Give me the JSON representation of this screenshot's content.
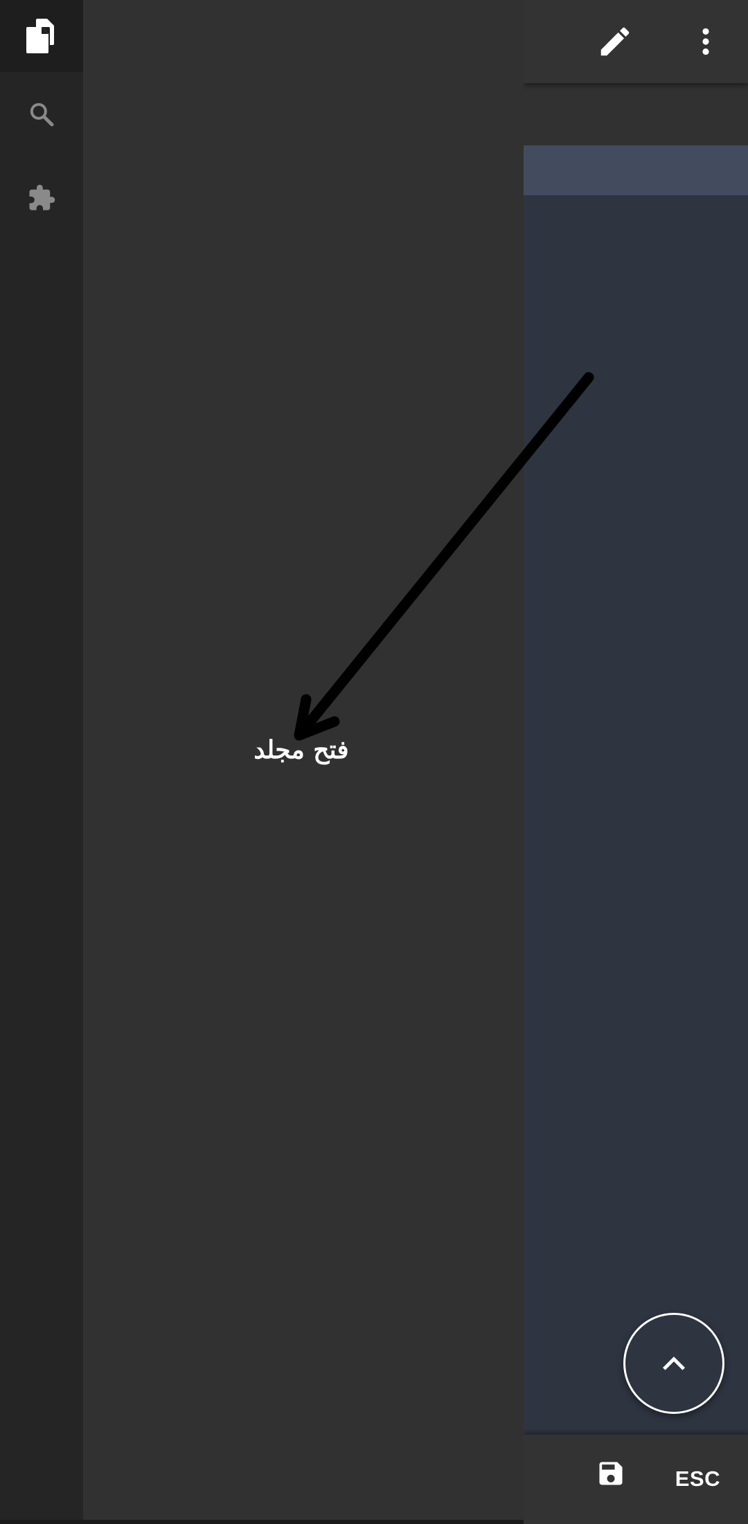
{
  "app": {
    "theme_colors": {
      "drawer_bg": "#313131",
      "activity_bar_bg": "#252525",
      "editor_bg": "#2e3440",
      "current_line": "#434c5e",
      "toolbar_bg": "#333333"
    }
  },
  "activity_bar": {
    "items": [
      {
        "icon": "files-icon",
        "active": true
      },
      {
        "icon": "search-icon",
        "active": false
      },
      {
        "icon": "extensions-icon",
        "active": false
      }
    ]
  },
  "toolbar": {
    "edit_icon": "pencil-icon",
    "more_icon": "more-vert-icon"
  },
  "bottom_bar": {
    "save_icon": "save-icon",
    "esc_label": "ESC"
  },
  "fab": {
    "icon": "chevron-up-icon"
  },
  "annotation": {
    "label": "فتح مجلد"
  }
}
